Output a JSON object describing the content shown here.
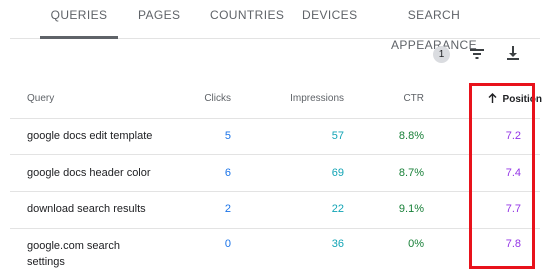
{
  "tabs": [
    {
      "label": "QUERIES",
      "active": true
    },
    {
      "label": "PAGES",
      "active": false
    },
    {
      "label": "COUNTRIES",
      "active": false
    },
    {
      "label": "DEVICES",
      "active": false
    },
    {
      "label": "SEARCH APPEARANCE",
      "active": false
    }
  ],
  "toolbar": {
    "filter_count": "1",
    "filter_icon": "filter-icon",
    "download_icon": "download-icon"
  },
  "table": {
    "headers": {
      "query": "Query",
      "clicks": "Clicks",
      "impressions": "Impressions",
      "ctr": "CTR",
      "position": "Position"
    },
    "sort": {
      "column": "position",
      "direction": "ascending",
      "icon": "arrow-up-icon"
    },
    "rows": [
      {
        "query": "google docs edit template",
        "clicks": "5",
        "impressions": "57",
        "ctr": "8.8%",
        "position": "7.2"
      },
      {
        "query": "google docs header color",
        "clicks": "6",
        "impressions": "69",
        "ctr": "8.7%",
        "position": "7.4"
      },
      {
        "query": "download search results",
        "clicks": "2",
        "impressions": "22",
        "ctr": "9.1%",
        "position": "7.7"
      },
      {
        "query": "google.com search settings",
        "clicks": "0",
        "impressions": "36",
        "ctr": "0%",
        "position": "7.8"
      }
    ]
  },
  "colors": {
    "clicks": "#1a73e8",
    "impressions": "#12a4b5",
    "ctr": "#188038",
    "position": "#9334e6",
    "highlight": "#e8121b"
  }
}
